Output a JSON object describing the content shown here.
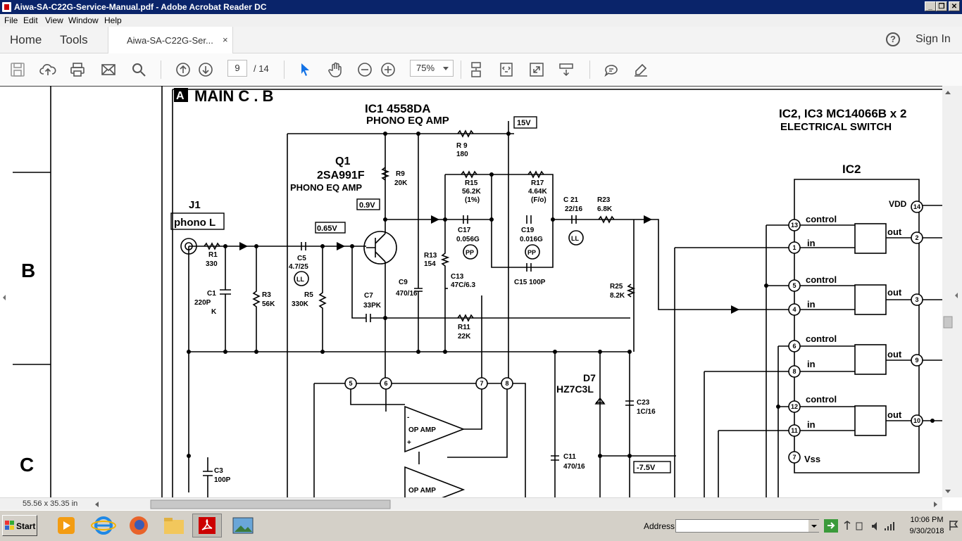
{
  "window": {
    "title": "Aiwa-SA-C22G-Service-Manual.pdf - Adobe Acrobat Reader DC",
    "buttons": {
      "minimize": "_",
      "maximize": "❐",
      "close": "✕"
    }
  },
  "menu": [
    "File",
    "Edit",
    "View",
    "Window",
    "Help"
  ],
  "nav": {
    "home": "Home",
    "tools": "Tools",
    "doc_tab": "Aiwa-SA-C22G-Ser...",
    "close_tab": "×",
    "help": "?",
    "sign_in": "Sign In"
  },
  "toolbar": {
    "page_current": "9",
    "page_total": "/ 14",
    "zoom": "75%"
  },
  "schematic": {
    "section": "A",
    "board": "MAIN C . B",
    "row_b": "B",
    "row_c": "C",
    "ic1_title": "IC1 4558DA",
    "ic1_sub": "PHONO EQ AMP",
    "ic23_title": "IC2, IC3 MC14066B x 2",
    "ic23_sub": "ELECTRICAL SWITCH",
    "v15": "15V",
    "v09": "0.9V",
    "v065": "0.65V",
    "v75": "-7.5V",
    "q1": "Q1",
    "q1_part": "2SA991F",
    "q1_sub": "PHONO EQ AMP",
    "j1": "J1",
    "j1_box": "phono L",
    "r1": "R1",
    "r1v": "330",
    "c1": "C1",
    "c1v": "220P",
    "c1k": "K",
    "r3": "R3",
    "r3v": "56K",
    "c5": "C5",
    "c5v": "4.7/25",
    "ll": "LL",
    "r5": "R5",
    "r5v": "330K",
    "r9": "R9",
    "r9v": "20K",
    "r9b": "R 9",
    "r9bv": "180",
    "c7": "C7",
    "c7v": "33PK",
    "c9": "C9",
    "c9v": "470/16",
    "r13": "R13",
    "r13v": "154",
    "c13": "C13",
    "c13v": "47C/6.3",
    "r15": "R15",
    "r15v": "56.2K",
    "r15t": "(1%)",
    "c17": "C17",
    "c17v": "0.056G",
    "pp": "PP",
    "r17": "R17",
    "r17v": "4.64K",
    "r17t": "(F/o)",
    "c19": "C19",
    "c19v": "0.016G",
    "c15": "C15  100P",
    "r11": "R11",
    "r11v": "22K",
    "c21": "C 21",
    "c21v": "22/16",
    "r23": "R23",
    "r23v": "6.8K",
    "r25": "R25",
    "r25v": "8.2K",
    "d7": "D7",
    "d7v": "HZ7C3L",
    "c23": "C23",
    "c23v": "1C/16",
    "c11": "C11",
    "c11v": "470/16",
    "c3": "C3",
    "c3v": "100P",
    "opamp": "OP AMP",
    "ic2": "IC2",
    "vdd": "VDD",
    "vss": "Vss",
    "control": "control",
    "in": "in",
    "out": "out",
    "pins_left": [
      "13",
      "1",
      "5",
      "4",
      "6",
      "8",
      "12",
      "11",
      "7"
    ],
    "pins_right": [
      "14",
      "2",
      "3",
      "9",
      "10"
    ],
    "pins_ic1": [
      "5",
      "6",
      "7",
      "8"
    ],
    "plus": "+",
    "minus": "-"
  },
  "status": {
    "dimensions": "55.56 x 35.35 in"
  },
  "taskbar": {
    "start": "Start",
    "address_label": "Address",
    "time": "10:06 PM",
    "date": "9/30/2018"
  }
}
